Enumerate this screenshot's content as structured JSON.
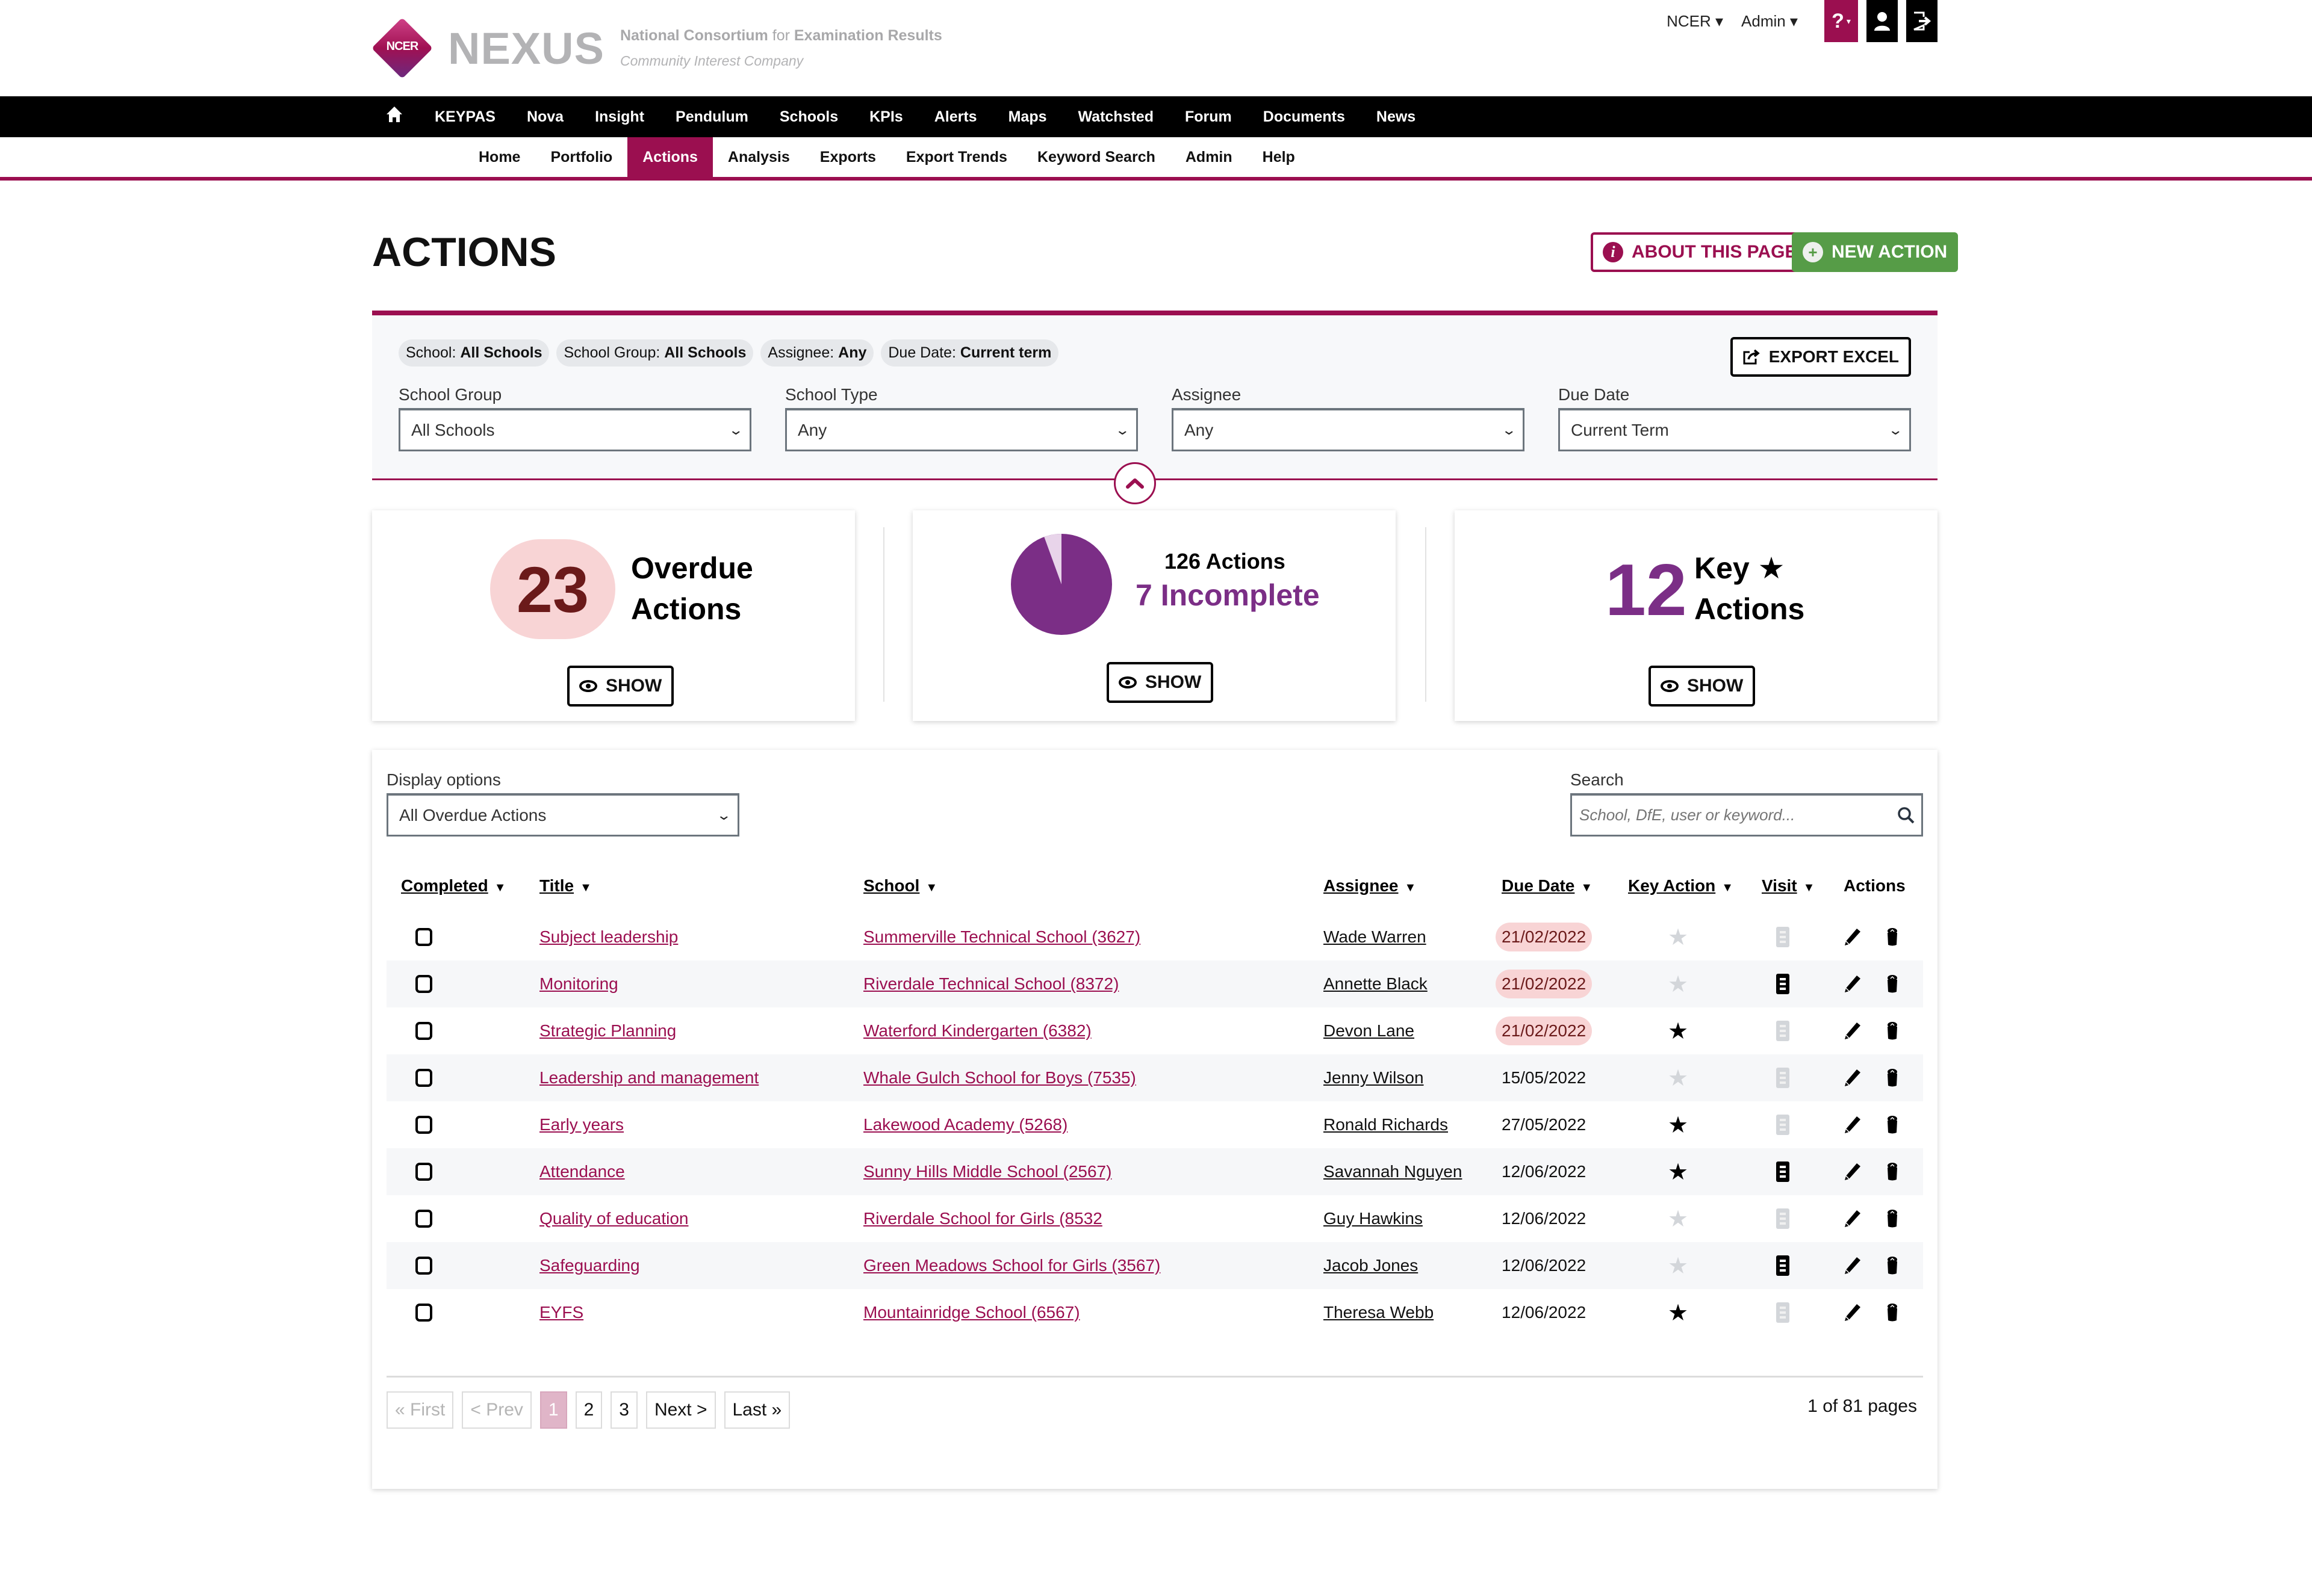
{
  "header": {
    "logo_badge": "NCER",
    "brand": "NEXUS",
    "tagline_bold1": "National Consortium",
    "tagline_for": " for ",
    "tagline_bold2": "Examination Results",
    "tagline_sub": "Community Interest Company",
    "org_menu": "NCER ▾",
    "user_menu": "Admin ▾",
    "help_icon": "?",
    "icons": [
      "help-icon",
      "user-icon",
      "logout-icon"
    ]
  },
  "main_nav": {
    "home_icon": "home-icon",
    "items": [
      "KEYPAS",
      "Nova",
      "Insight",
      "Pendulum",
      "Schools",
      "KPIs",
      "Alerts",
      "Maps",
      "Watchsted",
      "Forum",
      "Documents",
      "News"
    ]
  },
  "sub_nav": {
    "items": [
      "Home",
      "Portfolio",
      "Actions",
      "Analysis",
      "Exports",
      "Export Trends",
      "Keyword Search",
      "Admin",
      "Help"
    ],
    "active": "Actions"
  },
  "page": {
    "title": "ACTIONS",
    "about_label": "ABOUT THIS PAGE",
    "new_label": "NEW ACTION"
  },
  "filters": {
    "chips": [
      {
        "key": "School: ",
        "value": "All Schools"
      },
      {
        "key": "School Group: ",
        "value": "All Schools"
      },
      {
        "key": "Assignee: ",
        "value": "Any"
      },
      {
        "key": "Due Date: ",
        "value": "Current term"
      }
    ],
    "export_label": "EXPORT EXCEL",
    "fields": [
      {
        "label": "School Group",
        "value": "All Schools"
      },
      {
        "label": "School Type",
        "value": "Any"
      },
      {
        "label": "Assignee",
        "value": "Any"
      },
      {
        "label": "Due Date",
        "value": "Current Term"
      }
    ]
  },
  "stats": {
    "overdue": {
      "count": "23",
      "line1": "Overdue",
      "line2": "Actions",
      "show": "SHOW"
    },
    "completion": {
      "total": "126 Actions",
      "incomplete": "7 Incomplete",
      "total_n": 126,
      "incomplete_n": 7,
      "show": "SHOW",
      "colors": {
        "complete": "#7b2e86",
        "incomplete": "#e8d4ea"
      }
    },
    "key": {
      "count": "12",
      "line1": "Key",
      "line2": "Actions",
      "star": "★",
      "show": "SHOW"
    }
  },
  "table": {
    "display_label": "Display options",
    "display_value": "All Overdue Actions",
    "search_label": "Search",
    "search_placeholder": "School, DfE, user or keyword...",
    "columns": [
      "Completed",
      "Title",
      "School",
      "Assignee",
      "Due Date",
      "Key Action",
      "Visit",
      "Actions"
    ],
    "rows": [
      {
        "completed": false,
        "title": "Subject leadership",
        "school": "Summerville Technical School (3627)",
        "assignee": "Wade Warren",
        "due": "21/02/2022",
        "overdue": true,
        "key": false,
        "visit": false
      },
      {
        "completed": false,
        "title": "Monitoring",
        "school": "Riverdale Technical School (8372)",
        "assignee": "Annette Black",
        "due": "21/02/2022",
        "overdue": true,
        "key": false,
        "visit": true
      },
      {
        "completed": false,
        "title": "Strategic Planning",
        "school": "Waterford Kindergarten (6382)",
        "assignee": "Devon Lane",
        "due": "21/02/2022",
        "overdue": true,
        "key": true,
        "visit": false
      },
      {
        "completed": false,
        "title": "Leadership and management",
        "school": "Whale Gulch School for Boys (7535)",
        "assignee": "Jenny Wilson",
        "due": "15/05/2022",
        "overdue": false,
        "key": false,
        "visit": false
      },
      {
        "completed": false,
        "title": "Early years",
        "school": "Lakewood Academy (5268)",
        "assignee": "Ronald Richards",
        "due": "27/05/2022",
        "overdue": false,
        "key": true,
        "visit": false
      },
      {
        "completed": false,
        "title": "Attendance",
        "school": "Sunny Hills Middle School (2567)",
        "assignee": "Savannah Nguyen",
        "due": "12/06/2022",
        "overdue": false,
        "key": true,
        "visit": true
      },
      {
        "completed": false,
        "title": "Quality of education",
        "school": "Riverdale School for Girls (8532",
        "assignee": "Guy Hawkins",
        "due": "12/06/2022",
        "overdue": false,
        "key": false,
        "visit": false
      },
      {
        "completed": false,
        "title": "Safeguarding",
        "school": "Green Meadows School for Girls (3567)",
        "assignee": "Jacob Jones",
        "due": "12/06/2022",
        "overdue": false,
        "key": false,
        "visit": true
      },
      {
        "completed": false,
        "title": "EYFS",
        "school": "Mountainridge School (6567)",
        "assignee": "Theresa Webb",
        "due": "12/06/2022",
        "overdue": false,
        "key": true,
        "visit": false
      }
    ]
  },
  "pagination": {
    "first": "« First",
    "prev": "< Prev",
    "pages": [
      "1",
      "2",
      "3"
    ],
    "current": "1",
    "next": "Next >",
    "last": "Last »",
    "info": "1 of 81 pages"
  },
  "colors": {
    "brand": "#9b0f50",
    "success": "#569c47",
    "accent_purple": "#7b2e86",
    "overdue_bg": "#f8d4d5"
  }
}
